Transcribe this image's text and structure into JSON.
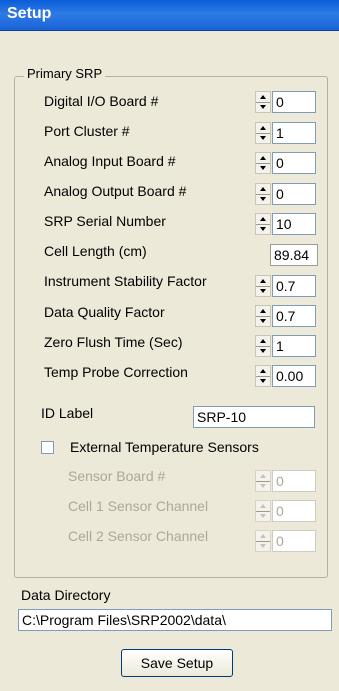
{
  "window": {
    "title": "Setup"
  },
  "group": {
    "title": "Primary SRP"
  },
  "fields": [
    {
      "label": "Digital I/O Board #",
      "value": "0",
      "control": "spinner"
    },
    {
      "label": "Port Cluster #",
      "value": "1",
      "control": "spinner"
    },
    {
      "label": "Analog Input Board #",
      "value": "0",
      "control": "spinner"
    },
    {
      "label": "Analog Output Board #",
      "value": "0",
      "control": "spinner"
    },
    {
      "label": "SRP Serial Number",
      "value": "10",
      "control": "spinner"
    },
    {
      "label": "Cell Length (cm)",
      "value": "89.84",
      "control": "readonly"
    },
    {
      "label": "Instrument Stability Factor",
      "value": "0.7",
      "control": "spinner"
    },
    {
      "label": "Data Quality Factor",
      "value": "0.7",
      "control": "spinner"
    },
    {
      "label": "Zero Flush Time (Sec)",
      "value": "1",
      "control": "spinner"
    },
    {
      "label": "Temp Probe Correction",
      "value": "0.00",
      "control": "spinner"
    }
  ],
  "id_label": {
    "label": "ID Label",
    "value": "SRP-10"
  },
  "external_sensors": {
    "label": "External Temperature Sensors",
    "checked": false,
    "fields": [
      {
        "label": "Sensor Board #",
        "value": "0"
      },
      {
        "label": "Cell 1 Sensor Channel",
        "value": "0"
      },
      {
        "label": "Cell 2 Sensor Channel",
        "value": "0"
      }
    ]
  },
  "data_directory": {
    "label": "Data Directory",
    "value": "C:\\Program Files\\SRP2002\\data\\"
  },
  "save_button": {
    "label": "Save Setup"
  },
  "colors": {
    "title_bar": "#0A5DD9",
    "window_bg": "#ECE9D8",
    "input_border": "#7F9DB9",
    "disabled_text": "#ACA899"
  }
}
